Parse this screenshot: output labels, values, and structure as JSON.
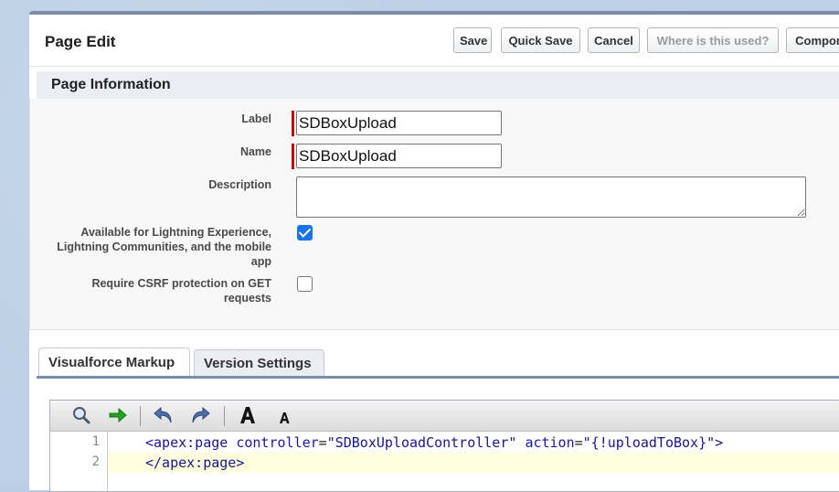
{
  "header": {
    "title": "Page Edit",
    "buttons": {
      "save": "Save",
      "quick_save": "Quick Save",
      "cancel": "Cancel",
      "where_used": "Where is this used?",
      "component": "Compon"
    }
  },
  "section": {
    "title": "Page Information"
  },
  "form": {
    "label_label": "Label",
    "label_value": "SDBoxUpload",
    "name_label": "Name",
    "name_value": "SDBoxUpload",
    "description_label": "Description",
    "description_value": "",
    "lightning_label": "Available for Lightning Experience, Lightning Communities, and the mobile app",
    "lightning_checked": true,
    "csrf_label": "Require CSRF protection on GET requests",
    "csrf_checked": false
  },
  "tabs": [
    {
      "label": "Visualforce Markup",
      "active": true
    },
    {
      "label": "Version Settings",
      "active": false
    }
  ],
  "editor": {
    "toolbar_icons": [
      "search-icon",
      "go-to-line-icon",
      "undo-icon",
      "redo-icon",
      "increase-font-icon",
      "decrease-font-icon"
    ],
    "lines": [
      {
        "number": "1",
        "tag_open": "<apex:page",
        "attr1": "controller",
        "val1": "\"SDBoxUploadController\"",
        "attr2": "action",
        "val2": "\"{!uploadToBox}\"",
        "tag_close": ">"
      },
      {
        "number": "2",
        "text": "</apex:page>"
      }
    ]
  },
  "colors": {
    "required": "#c00000",
    "checkbox_on": "#1a73e8",
    "tab_border": "#7a8ca8",
    "current_line": "#ffffdf"
  }
}
